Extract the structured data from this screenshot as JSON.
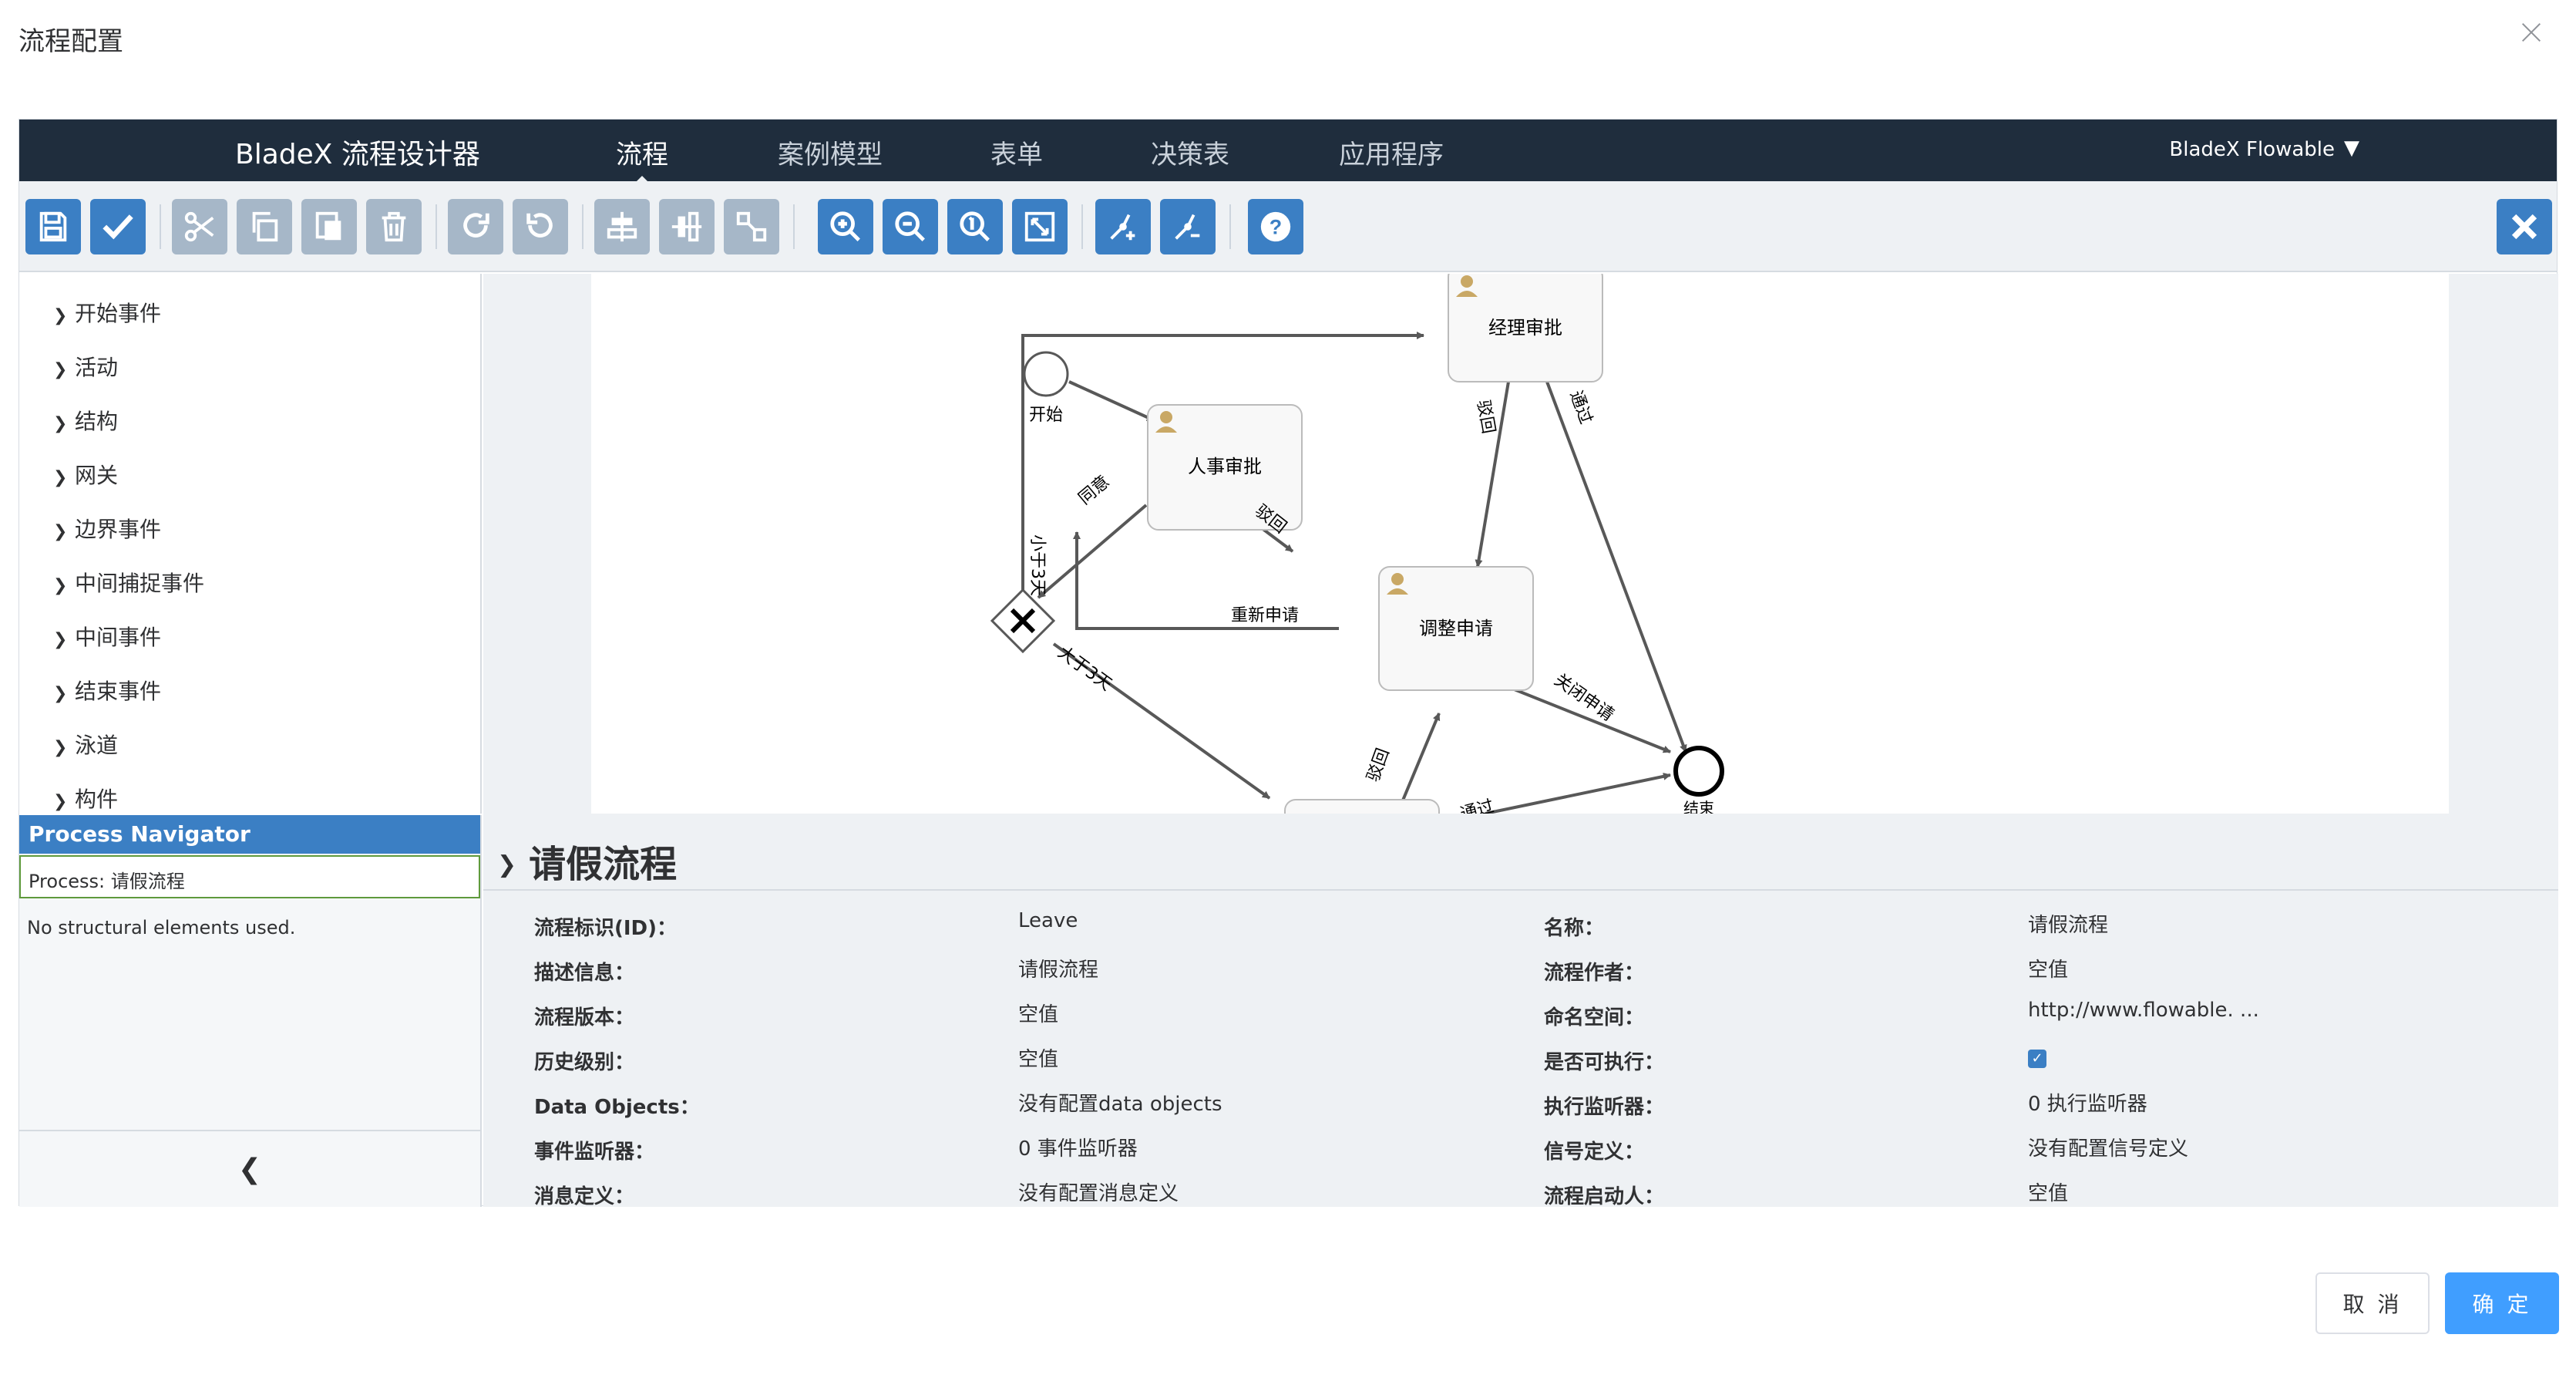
{
  "dialog": {
    "title": "流程配置",
    "cancel_label": "取 消",
    "ok_label": "确 定"
  },
  "navbar": {
    "brand": "BladeX 流程设计器",
    "tabs": [
      "流程",
      "案例模型",
      "表单",
      "决策表",
      "应用程序"
    ],
    "active_tab": "流程",
    "user_menu": "BladeX Flowable"
  },
  "toolbar": {
    "groups": [
      [
        "save-icon",
        "check-icon"
      ],
      [
        "cut-icon",
        "copy-icon",
        "paste-icon",
        "delete-icon"
      ],
      [
        "redo-icon",
        "undo-icon"
      ],
      [
        "align-horizontal-icon",
        "align-vertical-icon",
        "same-size-icon"
      ],
      [
        "zoom-in-icon",
        "zoom-out-icon",
        "zoom-actual-icon",
        "zoom-fit-icon"
      ],
      [
        "add-bendpoint-icon",
        "remove-bendpoint-icon"
      ],
      [
        "help-icon"
      ]
    ],
    "close_icon": "close-icon",
    "colors": {
      "active": "#3b7fc4",
      "disabled": "#a6b7c8"
    }
  },
  "palette": {
    "items": [
      "开始事件",
      "活动",
      "结构",
      "网关",
      "边界事件",
      "中间捕捉事件",
      "中间事件",
      "结束事件",
      "泳道",
      "构件"
    ]
  },
  "navigator": {
    "title": "Process Navigator",
    "process": "Process: 请假流程",
    "empty": "No structural elements used."
  },
  "diagram": {
    "start_label": "开始",
    "end_label": "结束",
    "tasks": {
      "hr": "人事审批",
      "manager": "经理审批",
      "adjust": "调整申请"
    },
    "flows": {
      "less3": "小于3天",
      "agree": "同意",
      "reject1": "驳回",
      "reject2": "驳回",
      "reject3": "驳回",
      "pass": "通过",
      "reapply": "重新申请",
      "close": "关闭申请",
      "more3": "大于3天",
      "pass2": "通过"
    }
  },
  "properties": {
    "title": "请假流程",
    "left": [
      {
        "label": "流程标识(ID)：",
        "value": "Leave"
      },
      {
        "label": "描述信息：",
        "value": "请假流程"
      },
      {
        "label": "流程版本：",
        "value": "空值"
      },
      {
        "label": "历史级别：",
        "value": "空值"
      },
      {
        "label": "Data Objects：",
        "value": "没有配置data objects"
      },
      {
        "label": "事件监听器：",
        "value": "0 事件监听器"
      },
      {
        "label": "消息定义：",
        "value": "没有配置消息定义"
      }
    ],
    "right": [
      {
        "label": "名称：",
        "value": "请假流程"
      },
      {
        "label": "流程作者：",
        "value": "空值"
      },
      {
        "label": "命名空间：",
        "value": "http://www.flowable. ..."
      },
      {
        "label": "是否可执行：",
        "value": ""
      },
      {
        "label": "执行监听器：",
        "value": "0 执行监听器"
      },
      {
        "label": "信号定义：",
        "value": "没有配置信号定义"
      },
      {
        "label": "流程启动人：",
        "value": "空值"
      }
    ],
    "executable_checked": true
  }
}
